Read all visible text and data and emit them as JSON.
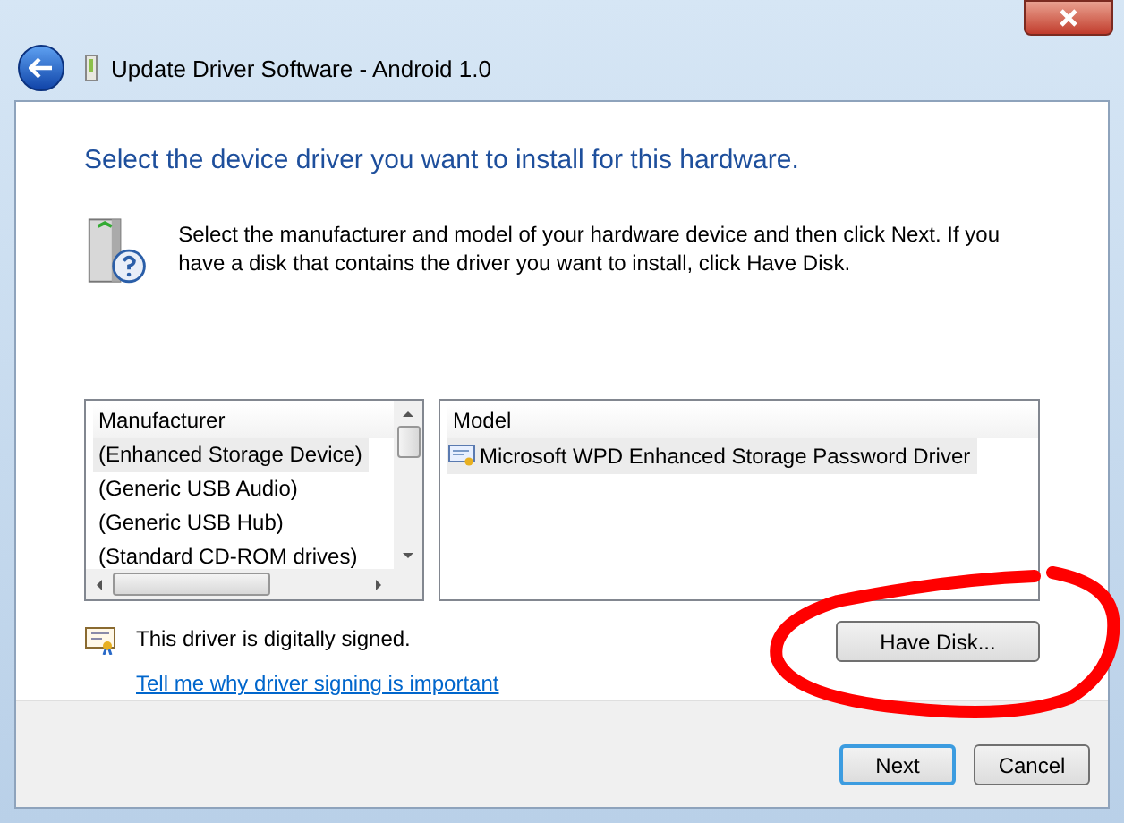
{
  "window": {
    "title": "Update Driver Software - Android 1.0"
  },
  "heading": "Select the device driver you want to install for this hardware.",
  "instructions": "Select the manufacturer and model of your hardware device and then click Next. If you have a disk that contains the driver you want to install, click Have Disk.",
  "manufacturer_list": {
    "header": "Manufacturer",
    "items": [
      {
        "label": "(Enhanced Storage Device)",
        "selected": true
      },
      {
        "label": "(Generic USB Audio)",
        "selected": false
      },
      {
        "label": "(Generic USB Hub)",
        "selected": false
      },
      {
        "label": "(Standard CD-ROM drives)",
        "selected": false
      }
    ]
  },
  "model_list": {
    "header": "Model",
    "items": [
      {
        "label": "Microsoft WPD Enhanced Storage Password Driver",
        "selected": true
      }
    ]
  },
  "signature": {
    "text": "This driver is digitally signed.",
    "link": "Tell me why driver signing is important"
  },
  "have_disk_button": "Have Disk...",
  "buttons": [
    {
      "label": "Next",
      "default": true
    },
    {
      "label": "Cancel",
      "default": false
    }
  ]
}
